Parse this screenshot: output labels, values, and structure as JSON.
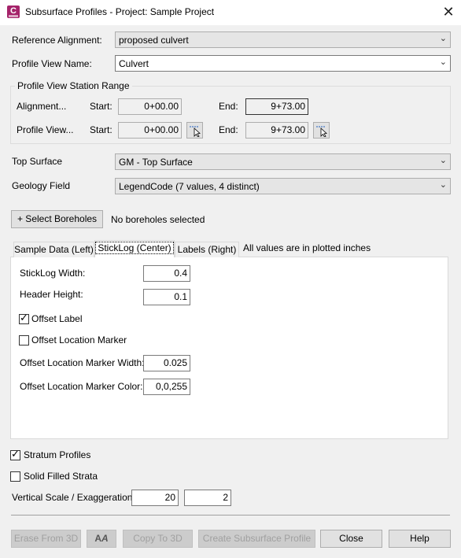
{
  "window": {
    "app_icon_letter": "C",
    "title": "Subsurface Profiles - Project: Sample Project",
    "close_glyph": "✕"
  },
  "reference_alignment": {
    "label": "Reference Alignment:",
    "value": "proposed culvert"
  },
  "profile_view_name": {
    "label": "Profile View Name:",
    "value": "Culvert"
  },
  "station_range": {
    "title": "Profile View Station Range",
    "alignment": {
      "label": "Alignment...",
      "start_label": "Start:",
      "start": "0+00.00",
      "end_label": "End:",
      "end": "9+73.00"
    },
    "profile_view": {
      "label": "Profile View...",
      "start_label": "Start:",
      "start": "0+00.00",
      "end_label": "End:",
      "end": "9+73.00"
    }
  },
  "top_surface": {
    "label": "Top Surface",
    "value": "GM - Top Surface"
  },
  "geology_field": {
    "label": "Geology Field",
    "value": "LegendCode (7 values, 4 distinct)"
  },
  "boreholes": {
    "button": "+ Select Boreholes",
    "status": "No boreholes selected"
  },
  "tabs": [
    {
      "label": "Sample Data (Left)",
      "active": false
    },
    {
      "label": "StickLog (Center)",
      "active": true
    },
    {
      "label": "Labels (Right)",
      "active": false
    }
  ],
  "tabs_note": "All values are in plotted inches",
  "sticklog": {
    "width": {
      "label": "StickLog Width:",
      "value": "0.4"
    },
    "header_height": {
      "label": "Header Height:",
      "value": "0.1"
    },
    "offset_label": {
      "label": "Offset Label",
      "checked": true
    },
    "offset_location_marker": {
      "label": "Offset Location Marker",
      "checked": false
    },
    "marker_width": {
      "label": "Offset Location Marker Width:",
      "value": "0.025"
    },
    "marker_color": {
      "label": "Offset Location Marker Color:",
      "value": "0,0,255"
    }
  },
  "stratum_profiles": {
    "label": "Stratum Profiles",
    "checked": true
  },
  "solid_filled_strata": {
    "label": "Solid Filled Strata",
    "checked": false
  },
  "vertical_scale": {
    "label": "Vertical Scale / Exaggeration:",
    "scale": "20",
    "exaggeration": "2"
  },
  "footer": {
    "erase_3d": "Erase From 3D",
    "aa_icon": "A",
    "copy_3d": "Copy To 3D",
    "create": "Create Subsurface Profile",
    "close": "Close",
    "help": "Help"
  },
  "colors": {
    "app_icon": "#a5236a",
    "background": "#f0f0f0"
  }
}
